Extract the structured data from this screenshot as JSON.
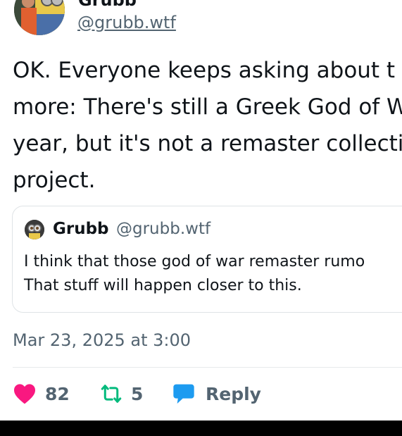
{
  "author": {
    "name": "Grubb",
    "handle": "@grubb.wtf"
  },
  "tweet": {
    "lines": [
      "OK. Everyone keeps asking about t",
      "more: There's still a Greek God of W",
      "year, but it's not a remaster collecti",
      "project."
    ]
  },
  "quote": {
    "name": "Grubb",
    "handle": "@grubb.wtf",
    "lines": [
      "I think that those god of war remaster rumo",
      "That stuff will happen closer to this."
    ]
  },
  "timestamp": "Mar 23, 2025 at 3:00",
  "actions": {
    "likes": "82",
    "retweets": "5",
    "reply_label": "Reply"
  },
  "colors": {
    "like": "#f91880",
    "retweet": "#00ba7c",
    "reply": "#1d9bf0",
    "secondary_text": "#536471"
  },
  "icons": [
    "heart-icon",
    "retweet-icon",
    "reply-bubble-icon"
  ]
}
